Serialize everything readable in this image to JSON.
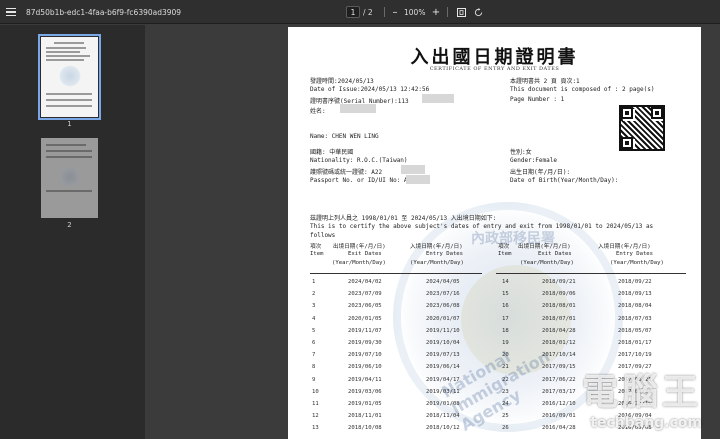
{
  "toolbar": {
    "filename": "87d50b1b-edc1-4faa-b6f9-fc6390ad3909",
    "page_current": "1",
    "page_total": "/ 2",
    "zoom_out": "–",
    "zoom": "100%",
    "zoom_in": "+",
    "icons": [
      "menu-icon",
      "fit-page-icon",
      "rotate-icon"
    ]
  },
  "sidebar": {
    "thumbnails": [
      {
        "label": "1",
        "selected": true
      },
      {
        "label": "2",
        "selected": false
      }
    ]
  },
  "document": {
    "title": "入出國日期證明書",
    "subtitle": "CERTIFICATE OF ENTRY AND EXIT DATES",
    "header_left": [
      "發證時間:2024/05/13",
      "Date of Issue:2024/05/13 12:42:56",
      "證明書序號(Serial Number):113",
      "姓名:"
    ],
    "header_right": [
      "本證明書共 2 頁   頁次:1",
      "This document is composed of : 2 page(s)",
      "Page Number : 1"
    ],
    "name_en": "Name: CHEN WEN LING",
    "nationality_zh": "國籍: 中華民國",
    "nationality_en": "Nationality: R.O.C.(Taiwan)",
    "passport_zh": "護照號碼或統一證號: A22",
    "passport_en": "Passport No. or ID/UI No: A22",
    "sex_zh": "性別:女",
    "sex_en": "Gender:Female",
    "dob_zh": "出生日期(年/月/日):",
    "dob_en": "Date of Birth(Year/Month/Day):",
    "certify_zh": "茲證明上列人員之 1998/01/01 至 2024/05/13 入出境日期如下:",
    "certify_en_1": "This is to certify the above subject's dates of entry and exit from 1998/01/01 to 2024/05/13 as",
    "certify_en_2": "follows",
    "table_header": {
      "item_zh": "項次",
      "exit_zh": "出境日期(年/月/日)",
      "entry_zh": "入境日期(年/月/日)",
      "item_en": "Item",
      "exit_en": "Exit Dates",
      "entry_en": "Entry Dates",
      "ymd": "(Year/Month/Day)"
    },
    "rows_left": [
      [
        "1",
        "2024/04/02",
        "2024/04/05"
      ],
      [
        "2",
        "2023/07/09",
        "2023/07/16"
      ],
      [
        "3",
        "2023/06/05",
        "2023/06/08"
      ],
      [
        "4",
        "2020/01/05",
        "2020/01/07"
      ],
      [
        "5",
        "2019/11/07",
        "2019/11/10"
      ],
      [
        "6",
        "2019/09/30",
        "2019/10/04"
      ],
      [
        "7",
        "2019/07/10",
        "2019/07/13"
      ],
      [
        "8",
        "2019/06/10",
        "2019/06/14"
      ],
      [
        "9",
        "2019/04/11",
        "2019/04/17"
      ],
      [
        "10",
        "2019/03/06",
        "2019/03/11"
      ],
      [
        "11",
        "2019/01/05",
        "2019/01/08"
      ],
      [
        "12",
        "2018/11/01",
        "2018/11/04"
      ],
      [
        "13",
        "2018/10/08",
        "2018/10/12"
      ]
    ],
    "rows_right": [
      [
        "14",
        "2018/09/21",
        "2018/09/22"
      ],
      [
        "15",
        "2018/09/06",
        "2018/09/13"
      ],
      [
        "16",
        "2018/08/01",
        "2018/08/04"
      ],
      [
        "17",
        "2018/07/01",
        "2018/07/03"
      ],
      [
        "18",
        "2018/04/28",
        "2018/05/07"
      ],
      [
        "19",
        "2018/01/12",
        "2018/01/17"
      ],
      [
        "20",
        "2017/10/14",
        "2017/10/19"
      ],
      [
        "21",
        "2017/09/15",
        "2017/09/27"
      ],
      [
        "22",
        "2017/06/22",
        "2017/06/25"
      ],
      [
        "23",
        "2017/03/17",
        "2017/03/20"
      ],
      [
        "24",
        "2016/12/10",
        "2016/12/15"
      ],
      [
        "25",
        "2016/09/01",
        "2016/09/04"
      ],
      [
        "26",
        "2016/04/28",
        "2016/05/08"
      ]
    ],
    "seal_text": "National Immigration Agency",
    "seal_zh": "內政部移民署"
  },
  "watermark": {
    "site_zh": "電腦王",
    "site_url": "techbang.com"
  }
}
